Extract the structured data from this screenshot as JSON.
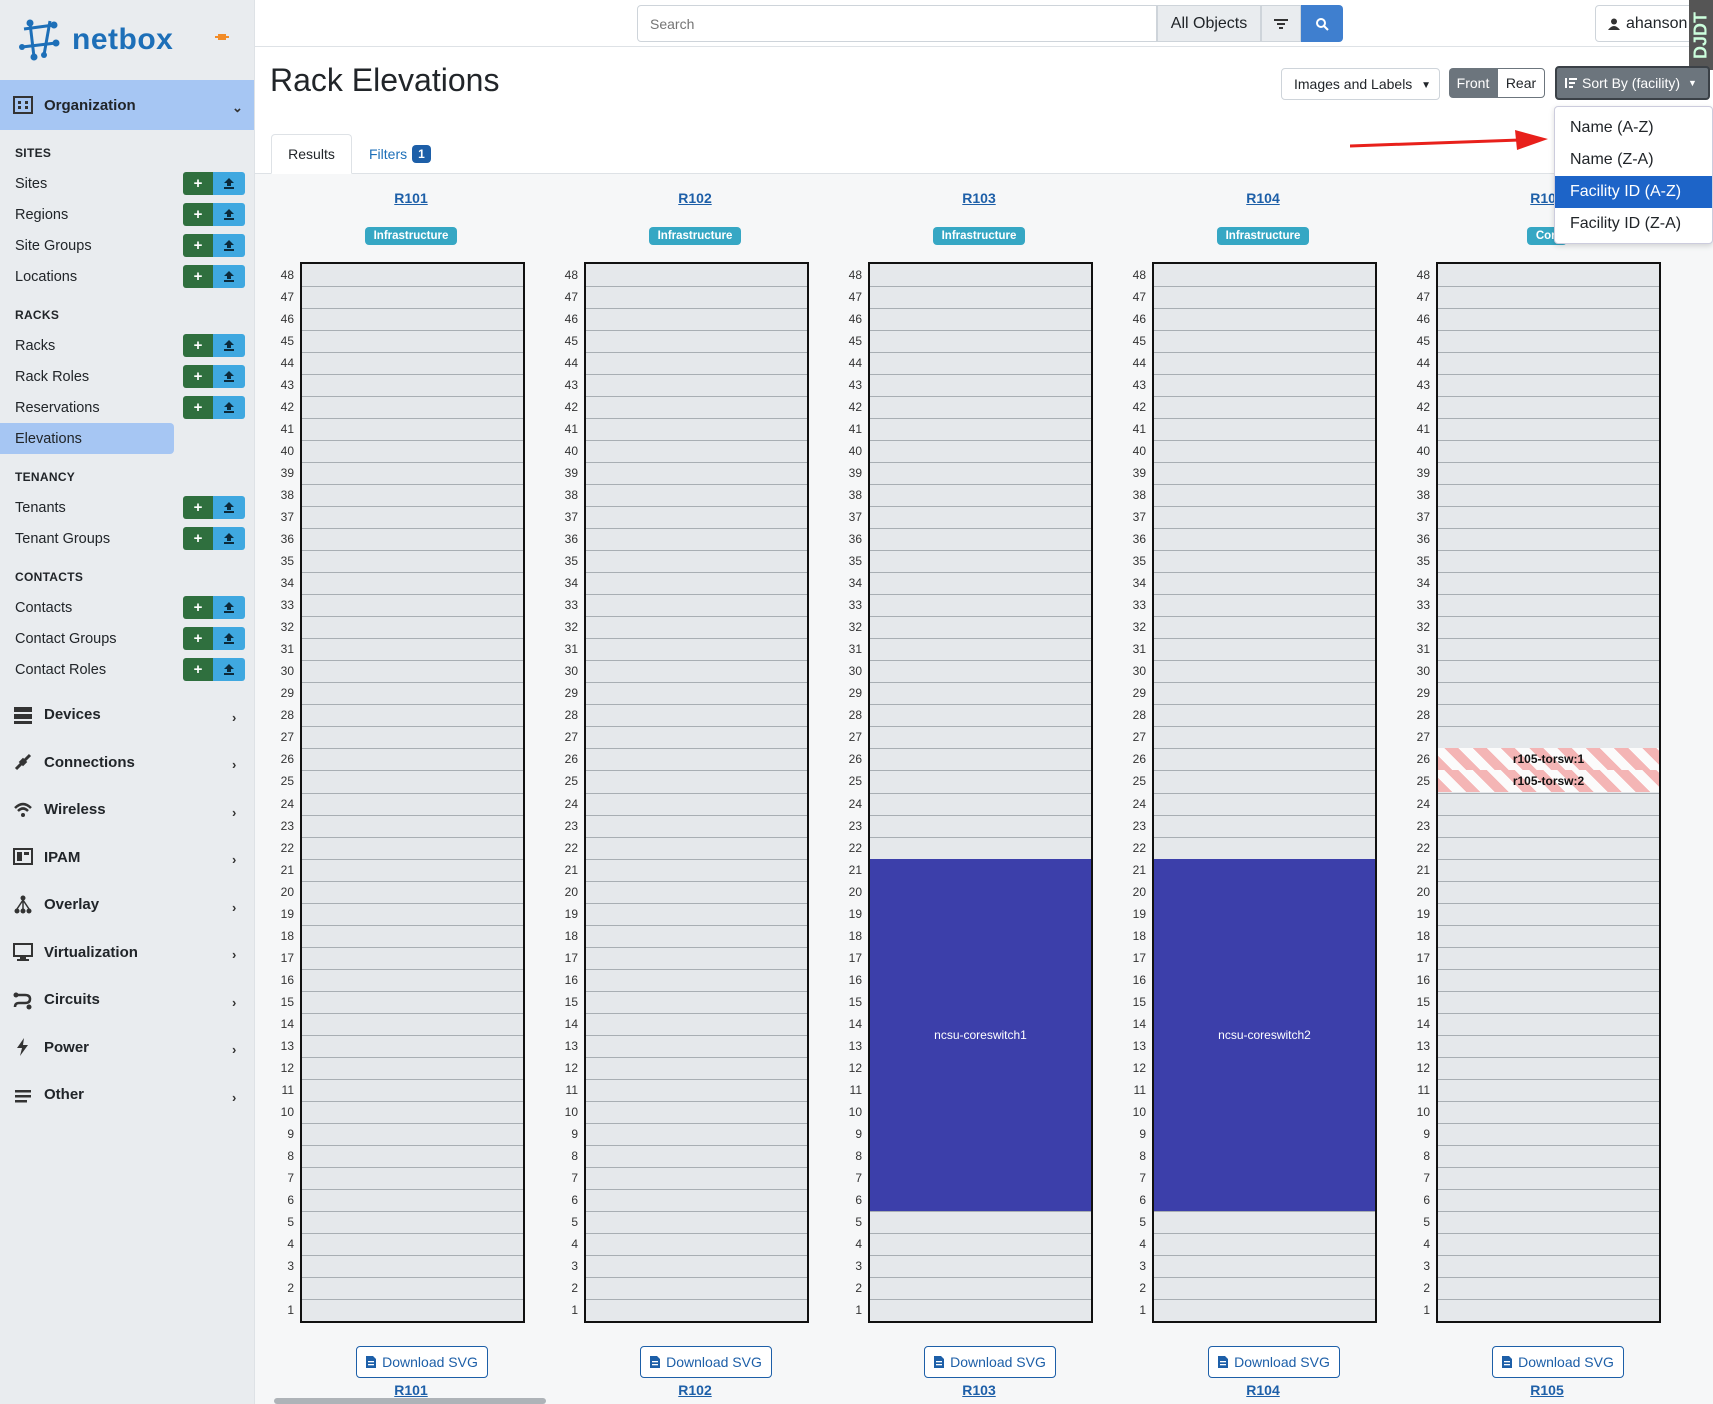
{
  "brand": {
    "name": "netbox"
  },
  "search": {
    "placeholder": "Search",
    "scope": "All Objects"
  },
  "user": {
    "name": "ahanson"
  },
  "sidebar": {
    "organization": "Organization",
    "sections": [
      {
        "title": "SITES",
        "items": [
          {
            "label": "Sites",
            "actions": true
          },
          {
            "label": "Regions",
            "actions": true
          },
          {
            "label": "Site Groups",
            "actions": true
          },
          {
            "label": "Locations",
            "actions": true
          }
        ]
      },
      {
        "title": "RACKS",
        "items": [
          {
            "label": "Racks",
            "actions": true
          },
          {
            "label": "Rack Roles",
            "actions": true
          },
          {
            "label": "Reservations",
            "actions": true
          },
          {
            "label": "Elevations",
            "actions": false,
            "active": true
          }
        ]
      },
      {
        "title": "TENANCY",
        "items": [
          {
            "label": "Tenants",
            "actions": true
          },
          {
            "label": "Tenant Groups",
            "actions": true
          }
        ]
      },
      {
        "title": "CONTACTS",
        "items": [
          {
            "label": "Contacts",
            "actions": true
          },
          {
            "label": "Contact Groups",
            "actions": true
          },
          {
            "label": "Contact Roles",
            "actions": true
          }
        ]
      }
    ],
    "menus": [
      "Devices",
      "Connections",
      "Wireless",
      "IPAM",
      "Overlay",
      "Virtualization",
      "Circuits",
      "Power",
      "Other"
    ]
  },
  "header": {
    "title": "Rack Elevations",
    "view_select": "Images and Labels",
    "front": "Front",
    "rear": "Rear",
    "sort_label": "Sort By (facility)"
  },
  "tabs": {
    "results": "Results",
    "filters": "Filters",
    "filters_count": "1"
  },
  "sort_menu": {
    "options": [
      "Name (A-Z)",
      "Name (Z-A)",
      "Facility ID (A-Z)",
      "Facility ID (Z-A)"
    ],
    "selected": "Facility ID (A-Z)"
  },
  "racks": [
    {
      "name": "R101",
      "role": "Infrastructure",
      "devices": [],
      "reservations": []
    },
    {
      "name": "R102",
      "role": "Infrastructure",
      "devices": [],
      "reservations": []
    },
    {
      "name": "R103",
      "role": "Infrastructure",
      "devices": [
        {
          "name": "ncsu-coreswitch1",
          "u_from": 6,
          "u_to": 21
        }
      ],
      "reservations": []
    },
    {
      "name": "R104",
      "role": "Infrastructure",
      "devices": [
        {
          "name": "ncsu-coreswitch2",
          "u_from": 6,
          "u_to": 21
        }
      ],
      "reservations": []
    },
    {
      "name": "R105",
      "role": "Con",
      "devices": [],
      "reservations": [
        {
          "name": "r105-torsw:1",
          "u": 26
        },
        {
          "name": "r105-torsw:2",
          "u": 25
        }
      ]
    }
  ],
  "rack_units": 48,
  "download_label": "Download SVG",
  "colors": {
    "accent": "#1d6fb8",
    "device": "#3c3faa",
    "role_badge": "#36a7c4",
    "add_button": "#2f6f3e",
    "import_button": "#3fa8e0"
  }
}
